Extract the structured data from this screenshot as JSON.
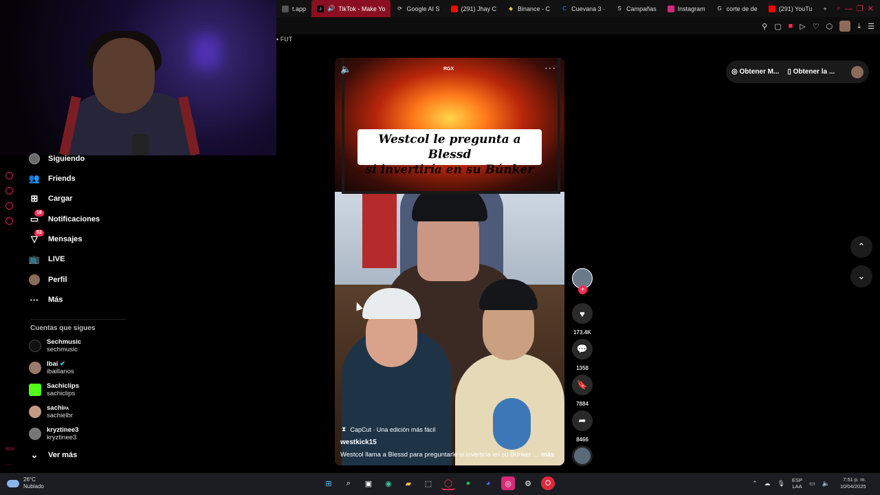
{
  "browser": {
    "tabs": [
      {
        "label": "t.app",
        "icon": "app-icon",
        "color": "#555"
      },
      {
        "label": "TikTok - Make Yo",
        "icon": "tiktok-icon",
        "color": "#000",
        "active": true
      },
      {
        "label": "Google AI S",
        "icon": "google-ai-icon",
        "color": "#4285f4"
      },
      {
        "label": "(291) Jhay C",
        "icon": "youtube-icon",
        "color": "#ff0000"
      },
      {
        "label": "Binance - C",
        "icon": "binance-icon",
        "color": "#f3ba2f"
      },
      {
        "label": "Cuevana 3 ·",
        "icon": "cuevana-icon",
        "color": "#3b82f6"
      },
      {
        "label": "Campañas",
        "icon": "campaign-icon",
        "color": "#eee"
      },
      {
        "label": "Instagram",
        "icon": "instagram-icon",
        "color": "#d62976"
      },
      {
        "label": "corte de de",
        "icon": "google-icon",
        "color": "#eee"
      },
      {
        "label": "(291) YouTu",
        "icon": "youtube-icon",
        "color": "#ff0000"
      }
    ],
    "new_tab": "+",
    "bookmark_label": "FUT",
    "window_controls": [
      "search-icon",
      "minimize-icon",
      "restore-icon",
      "close-icon"
    ]
  },
  "sidebar": {
    "items": [
      {
        "label": "Siguiendo",
        "icon": "following-avatar-icon"
      },
      {
        "label": "Friends",
        "icon": "friends-icon"
      },
      {
        "label": "Cargar",
        "icon": "upload-icon"
      },
      {
        "label": "Notificaciones",
        "icon": "notifications-icon",
        "badge": "18"
      },
      {
        "label": "Mensajes",
        "icon": "messages-icon",
        "badge": "53"
      },
      {
        "label": "LIVE",
        "icon": "live-icon"
      },
      {
        "label": "Perfil",
        "icon": "profile-avatar-icon"
      },
      {
        "label": "Más",
        "icon": "more-icon"
      }
    ],
    "following_header": "Cuentas que sigues",
    "accounts": [
      {
        "name": "Sechmusic",
        "user": "sechmusic"
      },
      {
        "name": "Ibai",
        "user": "ibaillanos",
        "verified": true
      },
      {
        "name": "Sachiclips",
        "user": "sachiclips"
      },
      {
        "name": "sachi",
        "suffix": "PA",
        "user": "sachielbr"
      },
      {
        "name": "kryztinee3",
        "user": "kryztinee3"
      }
    ],
    "see_more": "Ver más",
    "rail_label": "RGX"
  },
  "video": {
    "caption_line1": "Westcol le pregunta a Blessd",
    "caption_line2": "si invertiría en su Búnker",
    "watermark": "RGX",
    "capcut": "CapCut · Una edición más fácil",
    "author": "westkick15",
    "description": "Westcol llama a Blessd para preguntarle si invertiría en su Búnker ...",
    "more": "más"
  },
  "actions": {
    "likes": "173.4K",
    "comments": "1358",
    "saves": "7884",
    "shares": "8466"
  },
  "top_pill": {
    "coins": "Obtener M...",
    "app": "Obtener la ..."
  },
  "taskbar": {
    "temp": "26°C",
    "weather": "Nublado",
    "lang1": "ESP",
    "lang2": "LAA",
    "time": "7:51 p. m.",
    "date": "10/04/2025"
  },
  "colors": {
    "accent": "#fe2c55",
    "active_tab": "#8a0f22",
    "rail": "#d6224a"
  }
}
